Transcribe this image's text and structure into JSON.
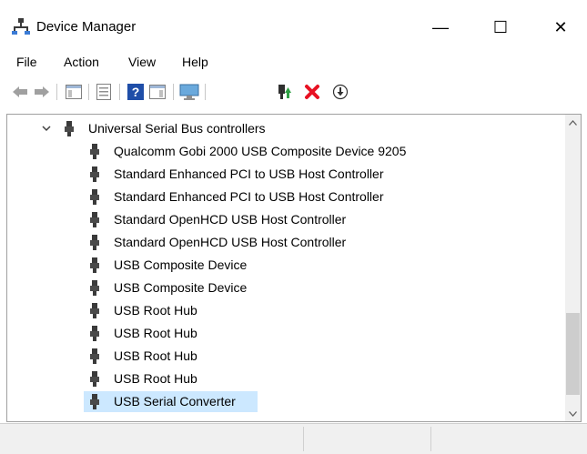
{
  "window": {
    "title": "Device Manager",
    "minimize_glyph": "—",
    "maximize_glyph": "☐",
    "close_glyph": "✕"
  },
  "menu": {
    "items": [
      "File",
      "Action",
      "View",
      "Help"
    ]
  },
  "toolbar": {
    "buttons": [
      "back-icon",
      "forward-icon",
      "show-hide-console-tree-icon",
      "properties-icon",
      "help-icon",
      "action-pane-icon",
      "scan-hardware-icon",
      "update-driver-icon",
      "uninstall-icon",
      "disable-device-icon"
    ],
    "uninstall_color": "#e81123"
  },
  "tree": {
    "category": {
      "label": "Universal Serial Bus controllers",
      "expanded": true,
      "icon": "usb-icon"
    },
    "devices": [
      "Qualcomm Gobi 2000 USB Composite Device 9205",
      "Standard Enhanced PCI to USB Host Controller",
      "Standard Enhanced PCI to USB Host Controller",
      "Standard OpenHCD USB Host Controller",
      "Standard OpenHCD USB Host Controller",
      "USB Composite Device",
      "USB Composite Device",
      "USB Root Hub",
      "USB Root Hub",
      "USB Root Hub",
      "USB Root Hub",
      "USB Serial Converter"
    ],
    "selected_device": "USB Serial Converter",
    "selection_color": "#cce8ff"
  },
  "scrollbar": {
    "up_glyph": "^",
    "down_glyph": "v"
  }
}
